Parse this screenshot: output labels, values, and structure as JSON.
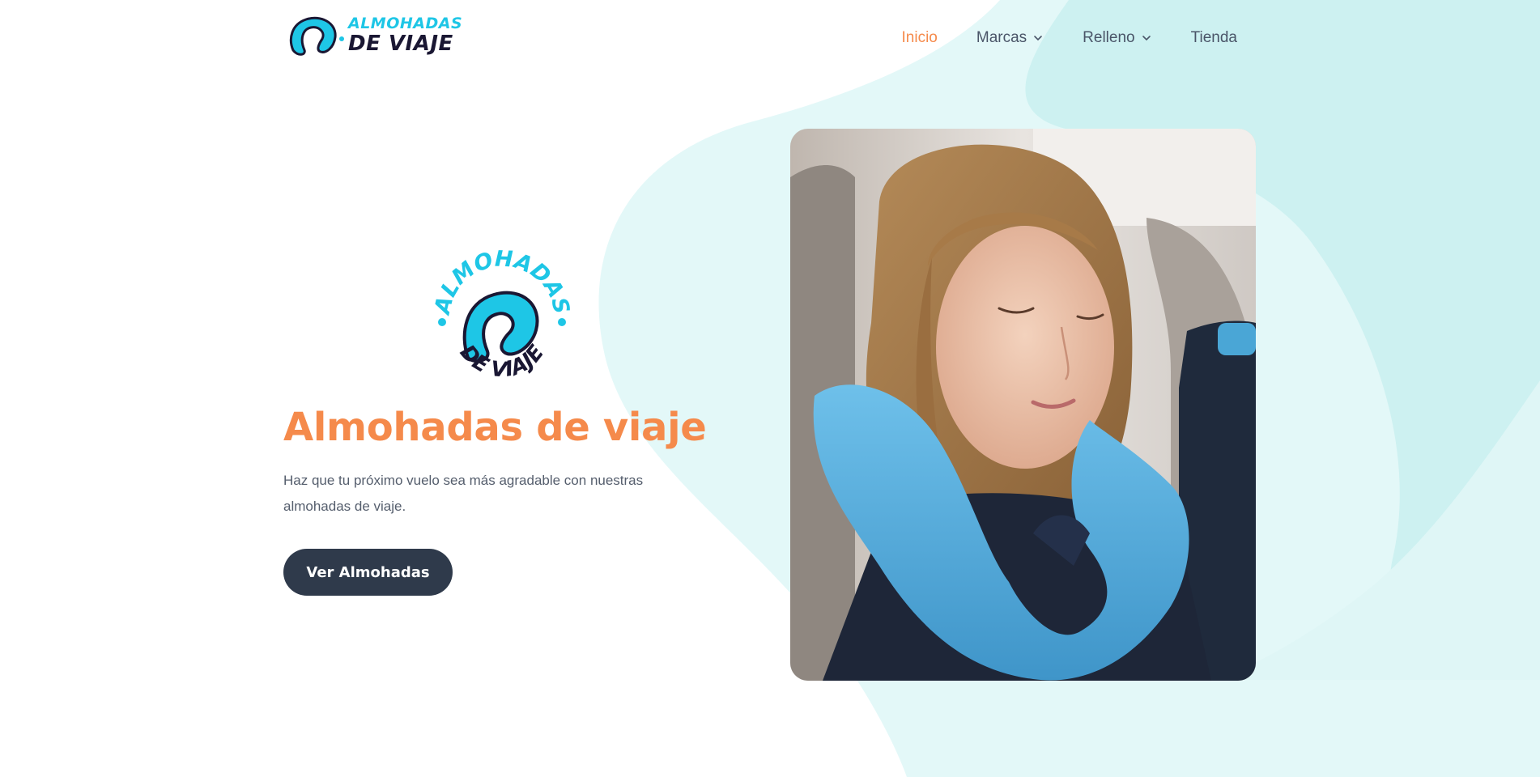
{
  "brand": {
    "logo_line1": "ALMOHADAS",
    "logo_line2": "DE VIAJE",
    "badge_top": "ALMOHADAS",
    "badge_bottom": "DE VIAJE"
  },
  "nav": {
    "items": [
      {
        "label": "Inicio",
        "active": true,
        "has_dropdown": false
      },
      {
        "label": "Marcas",
        "active": false,
        "has_dropdown": true
      },
      {
        "label": "Relleno",
        "active": false,
        "has_dropdown": true
      },
      {
        "label": "Tienda",
        "active": false,
        "has_dropdown": false
      }
    ]
  },
  "hero": {
    "title": "Almohadas de viaje",
    "subtitle": "Haz que tu próximo vuelo sea más agradable con nuestras almohadas de viaje.",
    "cta_label": "Ver Almohadas"
  },
  "colors": {
    "accent": "#f58a4b",
    "brand_cyan": "#1ec6e6",
    "brand_dark": "#1a1733",
    "button_bg": "#2f3a4b",
    "blob": "#e1f7f7"
  },
  "icons": {
    "chevron": "chevron-down-icon",
    "logo": "neck-pillow-logo"
  }
}
